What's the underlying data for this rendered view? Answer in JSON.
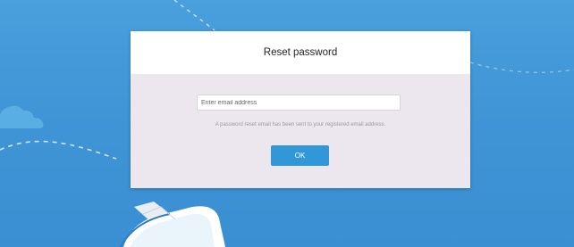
{
  "dialog": {
    "title": "Reset password",
    "email_placeholder": "Enter email address",
    "hint_text": "A password reset email has been sent to your registered email address.",
    "ok_label": "OK"
  },
  "colors": {
    "background": "#3f95d6",
    "dialog_header": "#ffffff",
    "dialog_body": "#ece7ee",
    "ok_button": "#3197d8"
  },
  "icons": [
    "cloud-icon",
    "boat-illustration"
  ]
}
